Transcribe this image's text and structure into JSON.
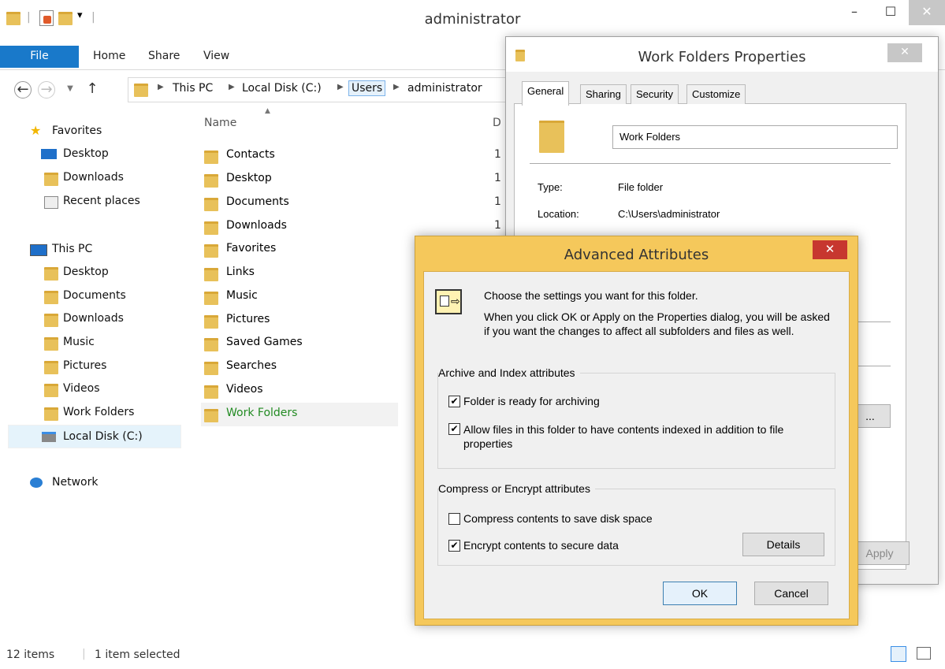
{
  "explorer": {
    "title": "administrator",
    "qat_dropdown": "▾",
    "window_controls": {
      "minimize": "–",
      "maximize": "☐",
      "close": "✕"
    },
    "ribbon_tabs": [
      "File",
      "Home",
      "Share",
      "View"
    ],
    "breadcrumb": [
      "This PC",
      "Local Disk (C:)",
      "Users",
      "administrator"
    ],
    "nav": {
      "favorites_header": "Favorites",
      "favorites": [
        "Desktop",
        "Downloads",
        "Recent places"
      ],
      "thispc_header": "This PC",
      "thispc": [
        "Desktop",
        "Documents",
        "Downloads",
        "Music",
        "Pictures",
        "Videos",
        "Work Folders",
        "Local Disk (C:)"
      ],
      "network": "Network"
    },
    "columns": {
      "name": "Name",
      "date": "D"
    },
    "files": [
      {
        "name": "Contacts",
        "date": "1"
      },
      {
        "name": "Desktop",
        "date": "1"
      },
      {
        "name": "Documents",
        "date": "1"
      },
      {
        "name": "Downloads",
        "date": "1"
      },
      {
        "name": "Favorites",
        "date": ""
      },
      {
        "name": "Links",
        "date": ""
      },
      {
        "name": "Music",
        "date": ""
      },
      {
        "name": "Pictures",
        "date": ""
      },
      {
        "name": "Saved Games",
        "date": ""
      },
      {
        "name": "Searches",
        "date": ""
      },
      {
        "name": "Videos",
        "date": ""
      },
      {
        "name": "Work Folders",
        "date": ""
      }
    ],
    "status": {
      "items": "12 items",
      "selected": "1 item selected"
    }
  },
  "properties": {
    "title": "Work Folders Properties",
    "tabs": [
      "General",
      "Sharing",
      "Security",
      "Customize"
    ],
    "name_value": "Work Folders",
    "type_label": "Type:",
    "type_value": "File folder",
    "location_label": "Location:",
    "location_value": "C:\\Users\\administrator",
    "ellipsis_button": "...",
    "apply_button": "Apply"
  },
  "advanced": {
    "title": "Advanced Attributes",
    "intro_line1": "Choose the settings you want for this folder.",
    "intro_line2": "When you click OK or Apply on the Properties dialog, you will be asked if you want the changes to affect all subfolders and files as well.",
    "archive_group": "Archive and Index attributes",
    "archive_checkbox": "Folder is ready for archiving",
    "archive_checked": true,
    "index_checkbox": "Allow files in this folder to have contents indexed in addition to file properties",
    "index_checked": true,
    "compress_group": "Compress or Encrypt attributes",
    "compress_checkbox": "Compress contents to save disk space",
    "compress_checked": false,
    "encrypt_checkbox": "Encrypt contents to secure data",
    "encrypt_checked": true,
    "details_button": "Details",
    "ok_button": "OK",
    "cancel_button": "Cancel",
    "checkmark": "✔"
  },
  "colors": {
    "file_tab": "#1979ca",
    "dialog_frame": "#f5c85b",
    "close_red": "#c7372f",
    "selected_text": "#228b22"
  }
}
